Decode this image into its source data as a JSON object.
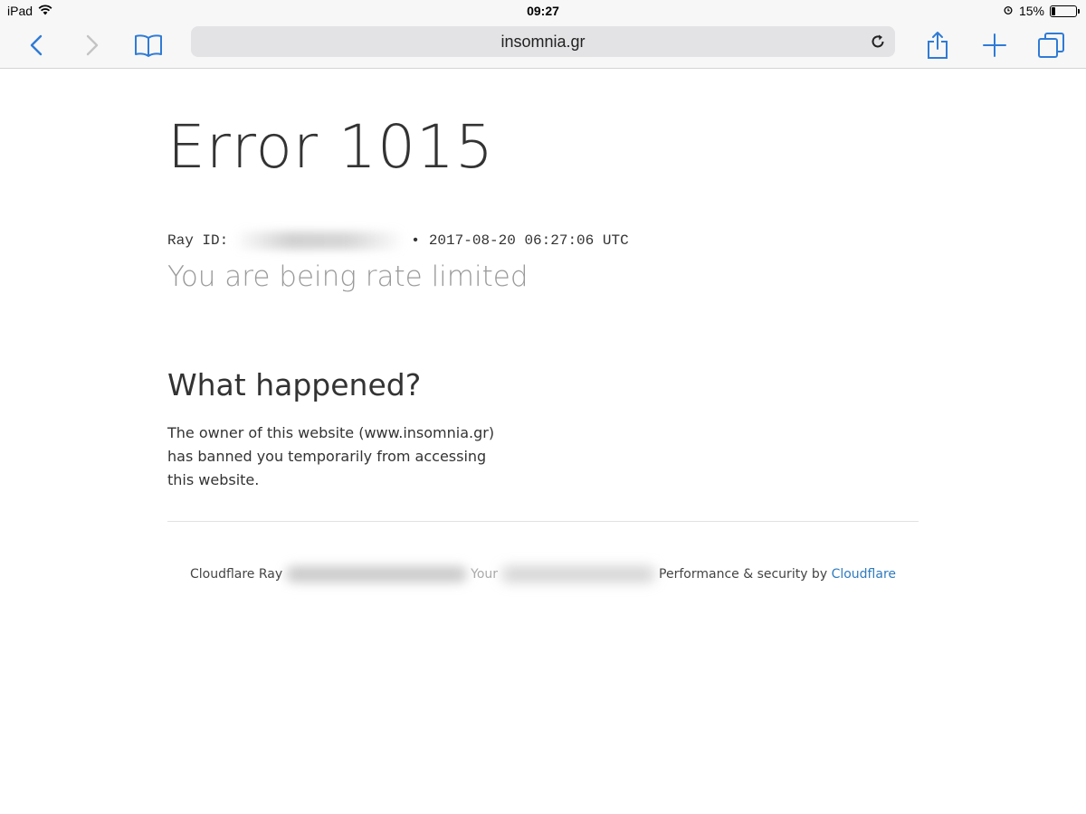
{
  "status_bar": {
    "device": "iPad",
    "time": "09:27",
    "battery_percent": "15%",
    "battery_level": 0.15,
    "icons": [
      "wifi-icon",
      "alarm-icon",
      "battery-icon"
    ]
  },
  "toolbar": {
    "url": "insomnia.gr",
    "accent_color": "#2f7bd6"
  },
  "page": {
    "title": "Error 1015",
    "ray_id_label": "Ray ID:",
    "ray_separator": "•",
    "timestamp": "2017-08-20 06:27:06 UTC",
    "subtitle": "You are being rate limited",
    "what_happened_heading": "What happened?",
    "what_happened_text": "The owner of this website (www.insomnia.gr) has banned you temporarily from accessing this website.",
    "footer": {
      "ray_label": "Cloudflare Ray",
      "your_label": "Your",
      "perf_text": "Performance & security by",
      "link_text": "Cloudflare",
      "link_color": "#2f7bbf"
    }
  }
}
